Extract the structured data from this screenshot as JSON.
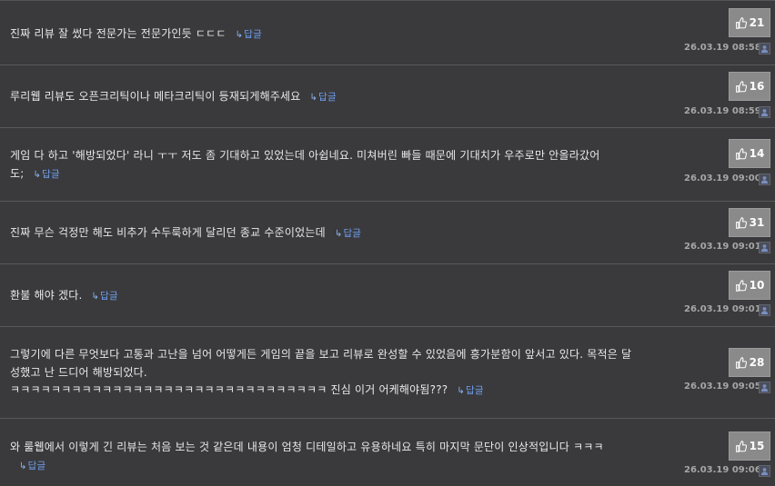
{
  "comments": [
    {
      "text": "진짜 리뷰 잘 썼다 전문가는 전문가인듯 ㄷㄷㄷ",
      "reply_label": "답글",
      "likes": "21",
      "date": "26.03.19 08:58"
    },
    {
      "text": "루리웹 리뷰도 오픈크리틱이나 메타크리틱이 등재되게해주세요",
      "reply_label": "답글",
      "likes": "16",
      "date": "26.03.19 08:59"
    },
    {
      "text": "게임 다 하고 '해방되었다' 라니 ㅜㅜ 저도 좀 기대하고 있었는데 아쉽네요. 미쳐버린 빠들 때문에 기대치가 우주로만 안올라갔어도;",
      "reply_label": "답글",
      "likes": "14",
      "date": "26.03.19 09:00"
    },
    {
      "text": "진짜 무슨 걱정만 해도 비추가 수두룩하게 달리던 종교 수준이었는데",
      "reply_label": "답글",
      "likes": "31",
      "date": "26.03.19 09:01"
    },
    {
      "text": "환불 해야 겠다.",
      "reply_label": "답글",
      "likes": "10",
      "date": "26.03.19 09:01"
    },
    {
      "text": "그렇기에 다른 무엇보다 고통과 고난을 넘어 어떻게든 게임의 끝을 보고 리뷰로 완성할 수 있었음에 흥가분함이 앞서고 있다. 목적은 달성했고 난 드디어 해방되었다.\nㅋㅋㅋㅋㅋㅋㅋㅋㅋㅋㅋㅋㅋㅋㅋㅋㅋㅋㅋㅋㅋㅋㅋㅋㅋㅋㅋㅋㅋㅋㅋ 진심 이거 어케해야됨???",
      "reply_label": "답글",
      "likes": "28",
      "date": "26.03.19 09:05"
    },
    {
      "text": "와 룰웹에서 이렇게 긴 리뷰는 처음 보는 것 같은데 내용이 엄청 디테일하고 유용하네요 특히 마지막 문단이 인상적입니다 ㅋㅋㅋ",
      "reply_label": "답글",
      "likes": "15",
      "date": "26.03.19 09:06"
    }
  ],
  "icons": {
    "like": "thumbs-up-icon",
    "reply": "reply-arrow-icon",
    "avatar": "user-icon"
  },
  "colors": {
    "reply": "#6f9ff0",
    "like_bg": "#8a8a8a",
    "background": "#3a3a3c"
  }
}
